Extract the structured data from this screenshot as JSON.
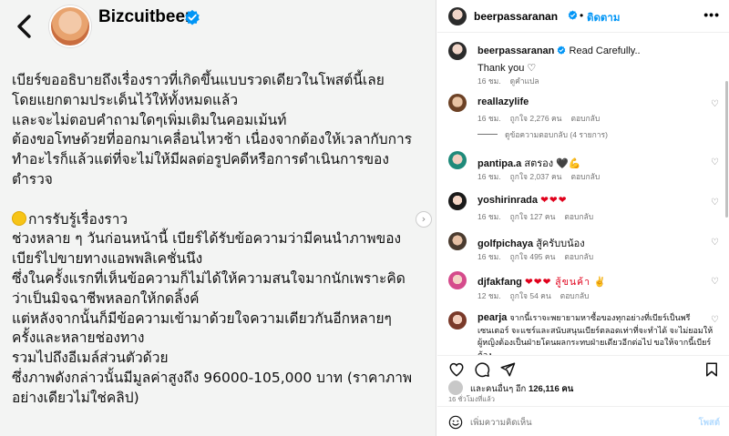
{
  "post_image": {
    "username": "Bizcuitbeer",
    "lines": [
      "เบียร์ขออธิบายถึงเรื่องราวที่เกิดขึ้นแบบรวดเดียวในโพสต์นี้เลย",
      "โดยแยกตามประเด็นไว้ให้ทั้งหมดแล้ว",
      "และจะไม่ตอบคำถามใดๆเพิ่มเติมในคอมเม้นท์",
      "ต้องขอโทษด้วยที่ออกมาเคลื่อนไหวช้า เนื่องจากต้องให้เวลากับการ",
      "ทำอะไรก็แล้วแต่ที่จะไม่ให้มีผลต่อรูปคดีหรือการดำเนินการของ",
      "ตำรวจ",
      "",
      "การรับรู้เรื่องราว",
      "ช่วงหลาย ๆ วันก่อนหน้านี้ เบียร์ได้รับข้อความว่ามีคนนำภาพของ",
      "เบียร์ไปขายทางแอพพลิเคชั่นนึง",
      "ซึ่งในครั้งแรกที่เห็นข้อความก็ไม่ได้ให้ความสนใจมากนักเพราะคิด",
      "ว่าเป็นมิจฉาชีพหลอกให้กดลิ้งค์",
      "แต่หลังจากนั้นก็มีข้อความเข้ามาด้วยใจความเดียวกันอีกหลายๆ",
      "ครั้งและหลายช่องทาง",
      "รวมไปถึงอีเมล์ส่วนตัวด้วย",
      "ซึ่งภาพดังกล่าวนั้นมีมูลค่าสูงถึง 96000-105,000 บาท (ราคาภาพ",
      "อย่างเดียวไม่ใช่คลิป)"
    ]
  },
  "header": {
    "username": "beerpassaranan",
    "separator": "•",
    "follow_label": "ติดตาม",
    "more_label": "•••"
  },
  "caption": {
    "username": "beerpassaranan",
    "text": "Read Carefully..",
    "text2": "Thank you ♡",
    "time": "16 ชม.",
    "translate": "ดูคำแปล"
  },
  "comments": [
    {
      "username": "reallazylife",
      "text": "",
      "time": "16 ชม.",
      "likes": "ถูกใจ 2,276 คน",
      "reply": "ตอบกลับ"
    },
    {
      "username": "pantipa.a",
      "text": "สตรอง 🖤💪",
      "time": "16 ชม.",
      "likes": "ถูกใจ 2,037 คน",
      "reply": "ตอบกลับ"
    },
    {
      "username": "yoshirinrada",
      "text": "❤❤❤",
      "time": "16 ชม.",
      "likes": "ถูกใจ 127 คน",
      "reply": "ตอบกลับ"
    },
    {
      "username": "golfpichaya",
      "text": "สู้ครับบน้อง",
      "time": "16 ชม.",
      "likes": "ถูกใจ 495 คน",
      "reply": "ตอบกลับ"
    },
    {
      "username": "djfakfang",
      "text": "❤❤❤ สู้ขนค้า ✌",
      "time": "12 ชม.",
      "likes": "ถูกใจ 54 คน",
      "reply": "ตอบกลับ"
    },
    {
      "username": "pearja",
      "text": "จากนี้เราจะพยายามหาซื้อของทุกอย่างที่เบียร์เป็นพรี เซนเตอร์ จะแชร์และสนับสนุนเบียร์ตลอดเท่าที่จะทำได้ จะไม่ยอมให้ผู้หญิงต้องเป็นฝ่ายโดนผลกระทบฝ่ายเดียวอีกต่อไป ขอให้จากนี้เบียร์ต้อง",
      "time": "",
      "likes": "",
      "reply": ""
    }
  ],
  "replies_toggle": "ดูข้อความตอบกลับ (4 รายการ)",
  "actions": {
    "likes_prefix": "และคนอื่นๆ อีก",
    "likes_count": "126,116 คน",
    "post_time": "16 ชั่วโมงที่แล้ว"
  },
  "composer": {
    "placeholder": "เพิ่มความคิดเห็น",
    "post_label": "โพสต์"
  },
  "colors": {
    "accent": "#0095f6",
    "verified": "#0095f6",
    "heart_red": "#e0001b"
  }
}
